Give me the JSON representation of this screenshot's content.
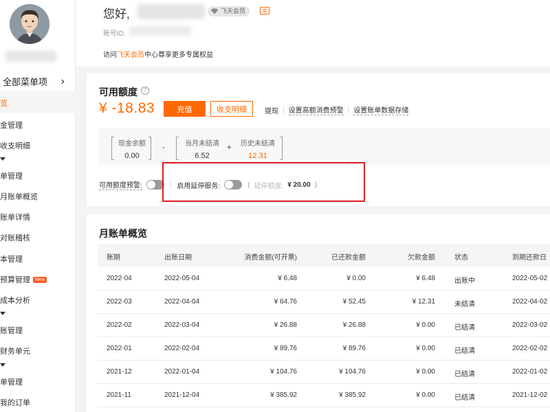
{
  "sidebar": {
    "all_menu_label": "全部菜单项",
    "items": [
      {
        "label": "览",
        "active": true
      },
      {
        "label": "金管理"
      },
      {
        "label": "收支明细"
      },
      {
        "label": "单管理"
      },
      {
        "label": "月账单概览"
      },
      {
        "label": "账单详情"
      },
      {
        "label": "对账稽核"
      },
      {
        "label": "本管理"
      },
      {
        "label": "预算管理",
        "badge": "New"
      },
      {
        "label": "成本分析"
      },
      {
        "label": "账管理"
      },
      {
        "label": "财务单元"
      },
      {
        "label": "单管理"
      },
      {
        "label": "我的订单"
      }
    ]
  },
  "header": {
    "greeting": "您好,",
    "vip_label": "飞天会员",
    "account_label": "账号ID:",
    "visit_prefix": "访问",
    "visit_link": "飞天会员",
    "visit_suffix": "中心尊享更多专属权益"
  },
  "credit": {
    "title": "可用额度",
    "help_icon": "?",
    "balance": "¥ -18.83",
    "recharge_label": "充值",
    "detail_label": "收支明细",
    "link_withdraw": "提现",
    "link_alert": "设置高额消费预警",
    "link_storage": "设置账单数据存储",
    "cash_label": "现金余额",
    "cash_value": "0.00",
    "minus": "-",
    "month_label": "当月未结清",
    "month_value": "6.52",
    "plus": "+",
    "history_label": "历史未结清",
    "history_value": "12.31",
    "alert_toggle_label": "可用额度预警:",
    "suspend_label": "启用延停服务:",
    "suspend_open": "(",
    "suspend_quota_label": "延停额度:",
    "suspend_quota_value": "¥ 20.00",
    "suspend_close": ")"
  },
  "monthly": {
    "title": "月账单概览",
    "columns": [
      "账期",
      "出账日期",
      "消费金额(可开票)",
      "已还款金额",
      "欠款金额",
      "状态",
      "到期还款日"
    ],
    "rows": [
      [
        "2022-04",
        "2022-05-04",
        "¥ 6.48",
        "¥ 0.00",
        "¥ 6.48",
        "出账中",
        "2022-05-02"
      ],
      [
        "2022-03",
        "2022-04-04",
        "¥ 64.76",
        "¥ 52.45",
        "¥ 12.31",
        "未结清",
        "2022-04-02"
      ],
      [
        "2022-02",
        "2022-03-04",
        "¥ 26.88",
        "¥ 26.88",
        "¥ 0.00",
        "已结清",
        "2022-03-02"
      ],
      [
        "2022-01",
        "2022-02-04",
        "¥ 89.76",
        "¥ 89.76",
        "¥ 0.00",
        "已结清",
        "2022-02-02"
      ],
      [
        "2021-12",
        "2022-01-04",
        "¥ 104.76",
        "¥ 104.76",
        "¥ 0.00",
        "已结清",
        "2022-01-02"
      ],
      [
        "2021-11",
        "2021-12-04",
        "¥ 385.92",
        "¥ 385.92",
        "¥ 0.00",
        "已结清",
        "2021-12-02"
      ]
    ]
  },
  "colors": {
    "accent": "#ff6a00",
    "highlight_box": "#e01e1e"
  }
}
